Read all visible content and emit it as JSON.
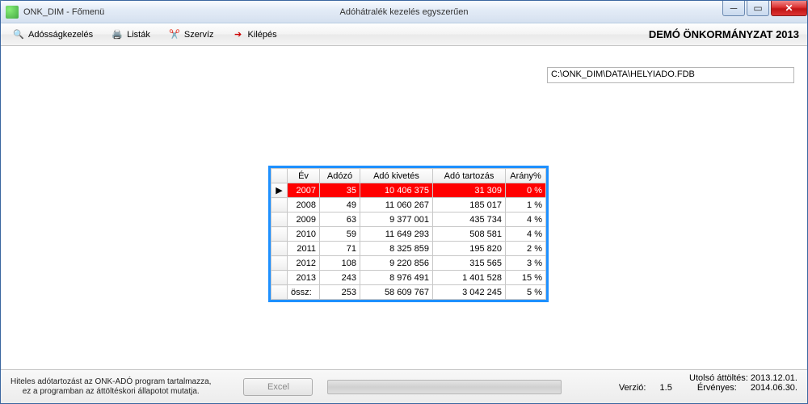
{
  "window": {
    "title_left": "ONK_DIM - Főmenü",
    "title_center": "Adóhátralék kezelés egyszerűen"
  },
  "toolbar": {
    "items": [
      {
        "label": "Adósságkezelés",
        "icon": "search-icon"
      },
      {
        "label": "Listák",
        "icon": "printer-icon"
      },
      {
        "label": "Szervíz",
        "icon": "tools-icon"
      },
      {
        "label": "Kilépés",
        "icon": "exit-icon"
      }
    ],
    "org_label": "DEMÓ ÖNKORMÁNYZAT 2013"
  },
  "path_field": "C:\\ONK_DIM\\DATA\\HELYIADO.FDB",
  "grid": {
    "headers": [
      "",
      "Év",
      "Adózó",
      "Adó kivetés",
      "Adó tartozás",
      "Arány%"
    ],
    "selected_index": 0,
    "rows": [
      {
        "ev": "2007",
        "adozo": "35",
        "kivetes": "10 406 375",
        "tartozas": "31 309",
        "arany": "0 %"
      },
      {
        "ev": "2008",
        "adozo": "49",
        "kivetes": "11 060 267",
        "tartozas": "185 017",
        "arany": "1 %"
      },
      {
        "ev": "2009",
        "adozo": "63",
        "kivetes": "9 377 001",
        "tartozas": "435 734",
        "arany": "4 %"
      },
      {
        "ev": "2010",
        "adozo": "59",
        "kivetes": "11 649 293",
        "tartozas": "508 581",
        "arany": "4 %"
      },
      {
        "ev": "2011",
        "adozo": "71",
        "kivetes": "8 325 859",
        "tartozas": "195 820",
        "arany": "2 %"
      },
      {
        "ev": "2012",
        "adozo": "108",
        "kivetes": "9 220 856",
        "tartozas": "315 565",
        "arany": "3 %"
      },
      {
        "ev": "2013",
        "adozo": "243",
        "kivetes": "8 976 491",
        "tartozas": "1 401 528",
        "arany": "15 %"
      }
    ],
    "totals": {
      "label": "össz:",
      "adozo": "253",
      "kivetes": "58 609 767",
      "tartozas": "3 042 245",
      "arany": "5 %"
    }
  },
  "footer": {
    "disclaimer_line1": "Hiteles adótartozást az ONK-ADÓ program tartalmazza,",
    "disclaimer_line2": "ez a programban az áttöltéskori állapotot mutatja.",
    "excel_button": "Excel",
    "last_load_label": "Utolsó áttöltés:",
    "last_load_value": "2013.12.01.",
    "version_label": "Verzió:",
    "version_value": "1.5",
    "valid_label": "Érvényes:",
    "valid_value": "2014.06.30."
  }
}
